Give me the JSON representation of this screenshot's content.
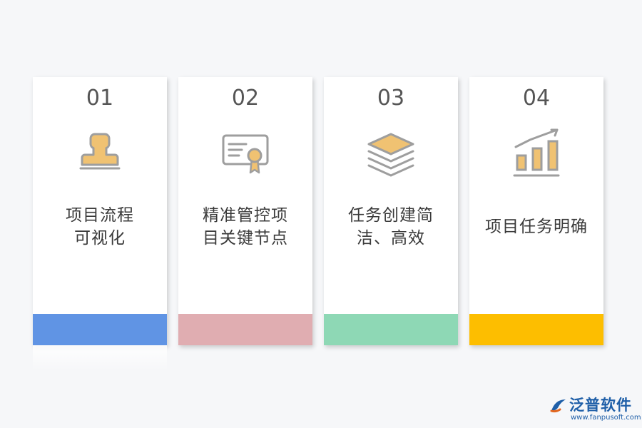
{
  "cards": [
    {
      "number": "01",
      "title_line1": "项目流程",
      "title_line2": "可视化",
      "icon": "stamp-icon",
      "bar_color": "#6094e4"
    },
    {
      "number": "02",
      "title_line1": "精准管控项",
      "title_line2": "目关键节点",
      "icon": "certificate-icon",
      "bar_color": "#e0adb1"
    },
    {
      "number": "03",
      "title_line1": "任务创建简",
      "title_line2": "洁、高效",
      "icon": "layers-icon",
      "bar_color": "#8ed8b5"
    },
    {
      "number": "04",
      "title_line1": "项目任务明确",
      "icon": "bar-chart-growth-icon",
      "bar_color": "#fdbe00"
    }
  ],
  "logo": {
    "name": "泛普软件",
    "url": "www.fanpusoft.com"
  },
  "colors": {
    "icon_fill": "#f0c272",
    "icon_stroke": "#9e9e9e"
  }
}
